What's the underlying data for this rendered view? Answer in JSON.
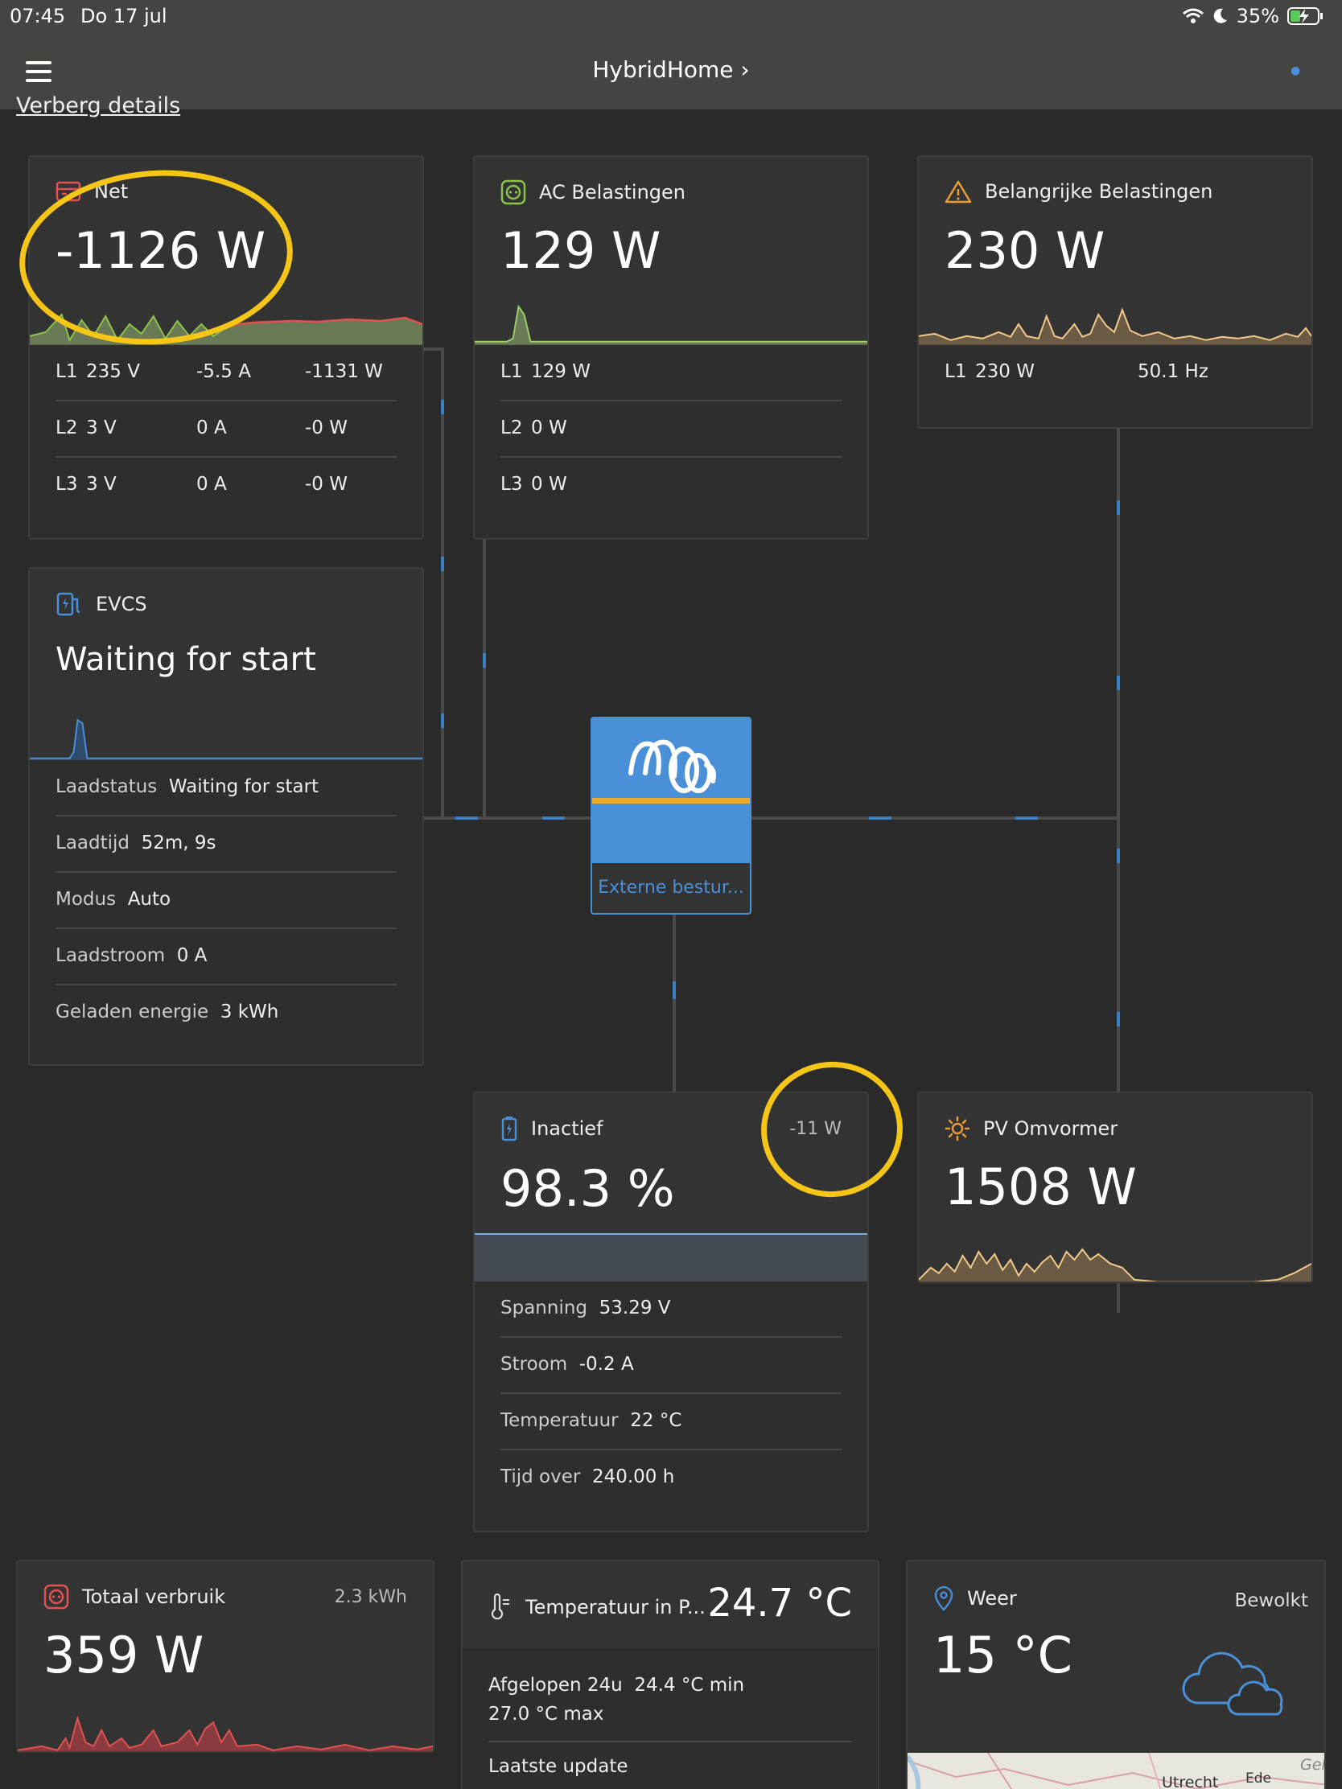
{
  "statusbar": {
    "time": "07:45",
    "date": "Do 17 jul",
    "battery": "35%"
  },
  "header": {
    "title": "HybridHome"
  },
  "toggle_link": "Verberg details",
  "grid": {
    "title": "Net",
    "value": "-1126 W",
    "rows": [
      {
        "phase": "L1",
        "voltage": "235 V",
        "current": "-5.5 A",
        "power": "-1131 W"
      },
      {
        "phase": "L2",
        "voltage": "3 V",
        "current": "0 A",
        "power": "-0 W"
      },
      {
        "phase": "L3",
        "voltage": "3 V",
        "current": "0 A",
        "power": "-0 W"
      }
    ]
  },
  "ac_loads": {
    "title": "AC Belastingen",
    "value": "129 W",
    "rows": [
      {
        "phase": "L1",
        "power": "129 W"
      },
      {
        "phase": "L2",
        "power": "0 W"
      },
      {
        "phase": "L3",
        "power": "0 W"
      }
    ]
  },
  "essential_loads": {
    "title": "Belangrijke Belastingen",
    "value": "230 W",
    "rows": [
      {
        "phase": "L1",
        "power": "230 W",
        "frequency": "50.1 Hz"
      }
    ]
  },
  "evcs": {
    "title": "EVCS",
    "status": "Waiting for start",
    "rows": [
      {
        "label": "Laadstatus",
        "value": "Waiting for start"
      },
      {
        "label": "Laadtijd",
        "value": "52m, 9s"
      },
      {
        "label": "Modus",
        "value": "Auto"
      },
      {
        "label": "Laadstroom",
        "value": "0 A"
      },
      {
        "label": "Geladen energie",
        "value": "3 kWh"
      }
    ]
  },
  "inverter": {
    "label": "Externe bestur..."
  },
  "battery": {
    "title": "Inactief",
    "power": "-11 W",
    "soc": "98.3 %",
    "soc_fraction": 0.983,
    "rows": [
      {
        "label": "Spanning",
        "value": "53.29 V"
      },
      {
        "label": "Stroom",
        "value": "-0.2 A"
      },
      {
        "label": "Temperatuur",
        "value": "22 °C"
      },
      {
        "label": "Tijd over",
        "value": "240.00 h"
      }
    ]
  },
  "pv": {
    "title": "PV Omvormer",
    "value": "1508 W"
  },
  "total": {
    "title": "Totaal verbruik",
    "energy": "2.3 kWh",
    "value": "359 W"
  },
  "temperature": {
    "title": "Temperatuur in P...",
    "value": "24.7 °C",
    "past_label": "Afgelopen 24u",
    "min": "24.4 °C min",
    "max": "27.0 °C max",
    "update_label": "Laatste update"
  },
  "weather": {
    "title": "Weer",
    "condition": "Bewolkt",
    "value": "15 °C",
    "map_labels": [
      "Utrecht",
      "Ede",
      "Geld"
    ]
  },
  "colors": {
    "accent": "#4a90d9",
    "grid": "#e0524f",
    "ac": "#8bc34a",
    "warning": "#e89b3a",
    "pv": "#e89b3a",
    "highlight": "#f5c518"
  }
}
